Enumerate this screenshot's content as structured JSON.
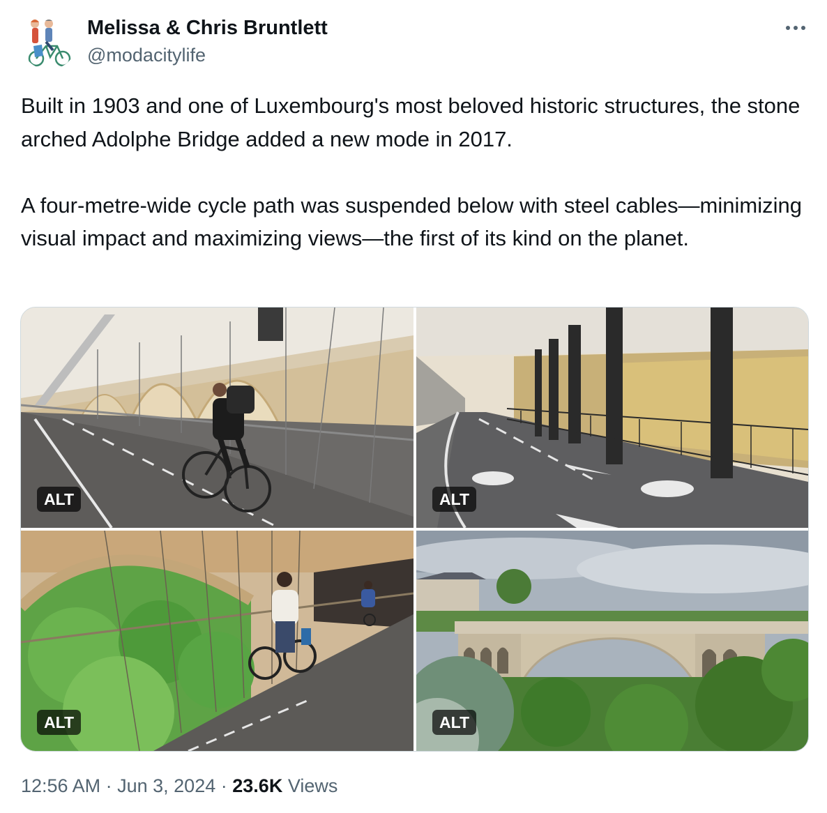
{
  "author": {
    "display_name": "Melissa & Chris Bruntlett",
    "handle": "@modacitylife"
  },
  "tweet": {
    "paragraphs": [
      "Built in 1903 and one of Luxembourg's most beloved historic structures, the stone arched Adolphe Bridge added a new mode in 2017.",
      "A four-metre-wide cycle path was suspended below with steel cables—minimizing visual impact and maximizing views—the first of its kind on the planet."
    ]
  },
  "media": {
    "photos": [
      {
        "alt_badge": "ALT"
      },
      {
        "alt_badge": "ALT"
      },
      {
        "alt_badge": "ALT"
      },
      {
        "alt_badge": "ALT"
      }
    ]
  },
  "meta": {
    "time": "12:56 AM",
    "separator": "·",
    "date": "Jun 3, 2024",
    "views_count": "23.6K",
    "views_label": "Views"
  },
  "colors": {
    "text_primary": "#0f1419",
    "text_secondary": "#536471",
    "border": "#cfd9de"
  },
  "icons": [
    "avatar-illustration",
    "more-options-icon"
  ]
}
